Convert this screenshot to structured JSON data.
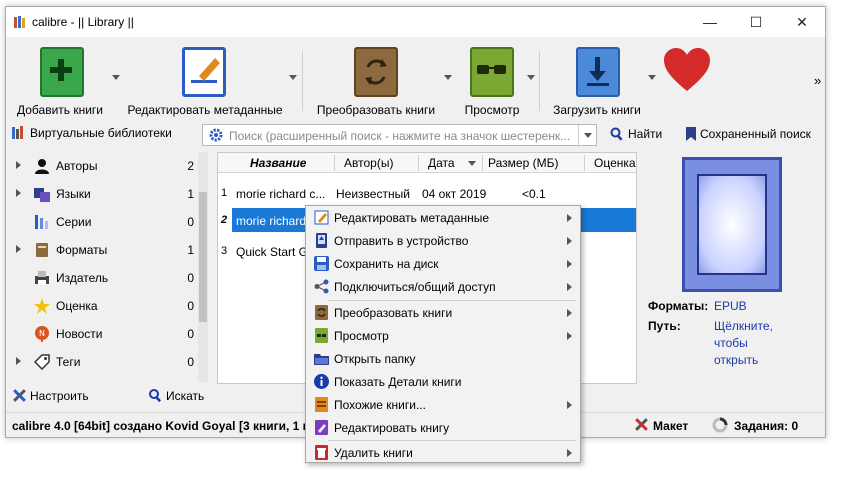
{
  "window": {
    "title": "calibre - || Library ||",
    "minimize": "—",
    "maximize": "☐",
    "close": "✕"
  },
  "toolbar": {
    "add_books": "Добавить книги",
    "edit_metadata": "Редактировать метаданные",
    "convert_books": "Преобразовать книги",
    "view": "Просмотр",
    "get_books": "Загрузить книги",
    "more": "»",
    "colors": {
      "add": "#3aa84a",
      "edit": "#2b5cc6",
      "convert": "#8d6a3e",
      "view": "#7aa833",
      "get": "#4a8ad9",
      "heart": "#d42a2a"
    }
  },
  "searchbar": {
    "virtual_libraries": "Виртуальные библиотеки",
    "placeholder": "Поиск (расширенный поиск - нажмите на значок шестеренк...",
    "find": "Найти",
    "saved_search": "Сохраненный поиск"
  },
  "categories": [
    {
      "label": "Авторы",
      "count": "2",
      "expandable": true,
      "icon": "person-icon"
    },
    {
      "label": "Языки",
      "count": "1",
      "expandable": true,
      "icon": "languages-icon"
    },
    {
      "label": "Серии",
      "count": "0",
      "expandable": false,
      "icon": "series-icon"
    },
    {
      "label": "Форматы",
      "count": "1",
      "expandable": true,
      "icon": "formats-icon"
    },
    {
      "label": "Издатель",
      "count": "0",
      "expandable": false,
      "icon": "publisher-icon"
    },
    {
      "label": "Оценка",
      "count": "0",
      "expandable": false,
      "icon": "star-icon"
    },
    {
      "label": "Новости",
      "count": "0",
      "expandable": false,
      "icon": "news-icon"
    },
    {
      "label": "Теги",
      "count": "0",
      "expandable": true,
      "icon": "tag-icon"
    }
  ],
  "leftbottom": {
    "configure": "Настроить",
    "search": "Искать"
  },
  "table": {
    "headers": {
      "title": "Название",
      "author": "Автор(ы)",
      "date": "Дата",
      "size": "Размер (МБ)",
      "rating": "Оценка"
    },
    "rows": [
      {
        "num": "1",
        "title": "morie richard c...",
        "author": "Неизвестный",
        "date": "04 окт 2019",
        "size": "<0.1"
      },
      {
        "num": "2",
        "title": "morie richard",
        "author": "",
        "date": "",
        "size": ""
      },
      {
        "num": "3",
        "title": "Quick Start Gu",
        "author": "",
        "date": "",
        "size": ""
      }
    ]
  },
  "details": {
    "formats_label": "Форматы:",
    "formats_value": "EPUB",
    "path_label": "Путь:",
    "path_value_1": "Щёлкните,",
    "path_value_2": "чтобы",
    "path_value_3": "открыть"
  },
  "status": {
    "left": "calibre 4.0 [64bit] создано Kovid Goyal",
    "books": "[3 книги, 1 n",
    "layout": "Макет",
    "jobs": "Задания: 0"
  },
  "context_menu": {
    "edit_metadata": "Редактировать метаданные",
    "send_to_device": "Отправить в устройство",
    "save_to_disk": "Сохранить на диск",
    "connect_share": "Подключиться/общий доступ",
    "convert_books": "Преобразовать книги",
    "view": "Просмотр",
    "open_folder": "Открыть папку",
    "show_details": "Показать Детали книги",
    "similar_books": "Похожие книги...",
    "edit_book": "Редактировать книгу",
    "delete_books": "Удалить книги"
  }
}
